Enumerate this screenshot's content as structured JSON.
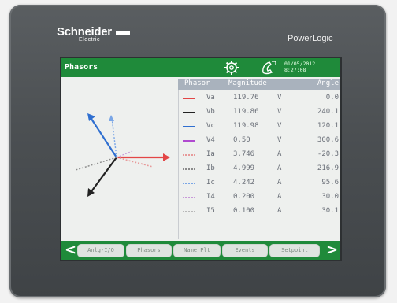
{
  "brand": {
    "name": "Schneider",
    "sub": "Electric"
  },
  "product": "PowerLogic",
  "screen": {
    "title": "Phasors",
    "date": "01/05/2012",
    "time": "8:27:08",
    "icons": [
      "gear-icon",
      "phone-icon"
    ]
  },
  "table": {
    "headers": {
      "phasor": "Phasor",
      "magnitude": "Magnitude",
      "angle": "Angle"
    },
    "rows": [
      {
        "name": "Va",
        "value": "119.76",
        "unit": "V",
        "angle": "0.0",
        "color": "#e34646",
        "style": "solid"
      },
      {
        "name": "Vb",
        "value": "119.86",
        "unit": "V",
        "angle": "240.1",
        "color": "#222222",
        "style": "solid"
      },
      {
        "name": "Vc",
        "value": "119.98",
        "unit": "V",
        "angle": "120.1",
        "color": "#2f6fd0",
        "style": "solid"
      },
      {
        "name": "V4",
        "value": "0.50",
        "unit": "V",
        "angle": "300.6",
        "color": "#b04ad0",
        "style": "solid"
      },
      {
        "name": "Ia",
        "value": "3.746",
        "unit": "A",
        "angle": "-20.3",
        "color": "#e79a9a",
        "style": "dotted"
      },
      {
        "name": "Ib",
        "value": "4.999",
        "unit": "A",
        "angle": "216.9",
        "color": "#8a8a8a",
        "style": "dotted"
      },
      {
        "name": "Ic",
        "value": "4.242",
        "unit": "A",
        "angle": "95.6",
        "color": "#7aa6e6",
        "style": "dotted"
      },
      {
        "name": "I4",
        "value": "0.200",
        "unit": "A",
        "angle": "30.0",
        "color": "#c89ad8",
        "style": "dotted"
      },
      {
        "name": "I5",
        "value": "0.100",
        "unit": "A",
        "angle": "30.1",
        "color": "#b8b8b8",
        "style": "dotted"
      }
    ]
  },
  "footer": {
    "left_arrow": "<",
    "right_arrow": ">",
    "buttons": [
      "Anlg-I/O",
      "Phasors",
      "Name Plt",
      "Events",
      "Setpoint"
    ]
  },
  "colors": {
    "bezel": "#4b4f52",
    "header_green": "#1f8a3a",
    "table_header": "#a9b2bd"
  }
}
